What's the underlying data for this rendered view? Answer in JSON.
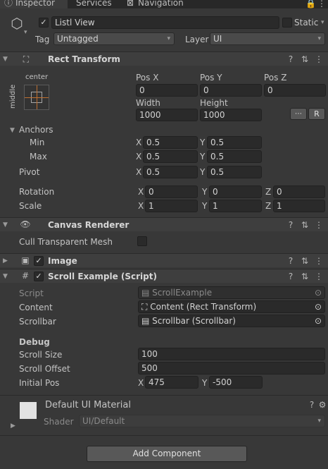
{
  "tabs": [
    {
      "label": "Inspector"
    },
    {
      "label": "Services"
    },
    {
      "label": "Navigation"
    }
  ],
  "object": {
    "name": "Listl View",
    "static_label": "Static",
    "tag_label": "Tag",
    "tag_value": "Untagged",
    "layer_label": "Layer",
    "layer_value": "UI"
  },
  "rect_transform": {
    "title": "Rect Transform",
    "anchor_preset": {
      "horizontal": "center",
      "vertical": "middle"
    },
    "pos_x_label": "Pos X",
    "pos_y_label": "Pos Y",
    "pos_z_label": "Pos Z",
    "pos_x": "0",
    "pos_y": "0",
    "pos_z": "0",
    "width_label": "Width",
    "height_label": "Height",
    "width": "1000",
    "height": "1000",
    "raw_button": "R",
    "anchors_label": "Anchors",
    "min_label": "Min",
    "max_label": "Max",
    "min_x": "0.5",
    "min_y": "0.5",
    "max_x": "0.5",
    "max_y": "0.5",
    "pivot_label": "Pivot",
    "pivot_x": "0.5",
    "pivot_y": "0.5",
    "rotation_label": "Rotation",
    "rot_x": "0",
    "rot_y": "0",
    "rot_z": "0",
    "scale_label": "Scale",
    "scale_x": "1",
    "scale_y": "1",
    "scale_z": "1",
    "axis_x": "X",
    "axis_y": "Y",
    "axis_z": "Z"
  },
  "canvas_renderer": {
    "title": "Canvas Renderer",
    "cull_label": "Cull Transparent Mesh"
  },
  "image": {
    "title": "Image"
  },
  "scroll_example": {
    "title": "Scroll Example (Script)",
    "script_label": "Script",
    "script_value": "ScrollExample",
    "content_label": "Content",
    "content_value": "Content (Rect Transform)",
    "scrollbar_label": "Scrollbar",
    "scrollbar_value": "Scrollbar (Scrollbar)",
    "debug_label": "Debug",
    "scroll_size_label": "Scroll Size",
    "scroll_size": "100",
    "scroll_offset_label": "Scroll Offset",
    "scroll_offset": "500",
    "initial_pos_label": "Initial Pos",
    "initial_x": "475",
    "initial_y": "-500"
  },
  "material": {
    "name": "Default UI Material",
    "shader_label": "Shader",
    "shader_value": "UI/Default"
  },
  "add_component_label": "Add Component",
  "icons": {
    "help": "?",
    "presets": "⇅",
    "menu": "⋮",
    "gear": "⚙",
    "target": "⊙",
    "dropdown": "▾",
    "fold_open": "▼",
    "fold_closed": "▶",
    "check": "✓"
  }
}
